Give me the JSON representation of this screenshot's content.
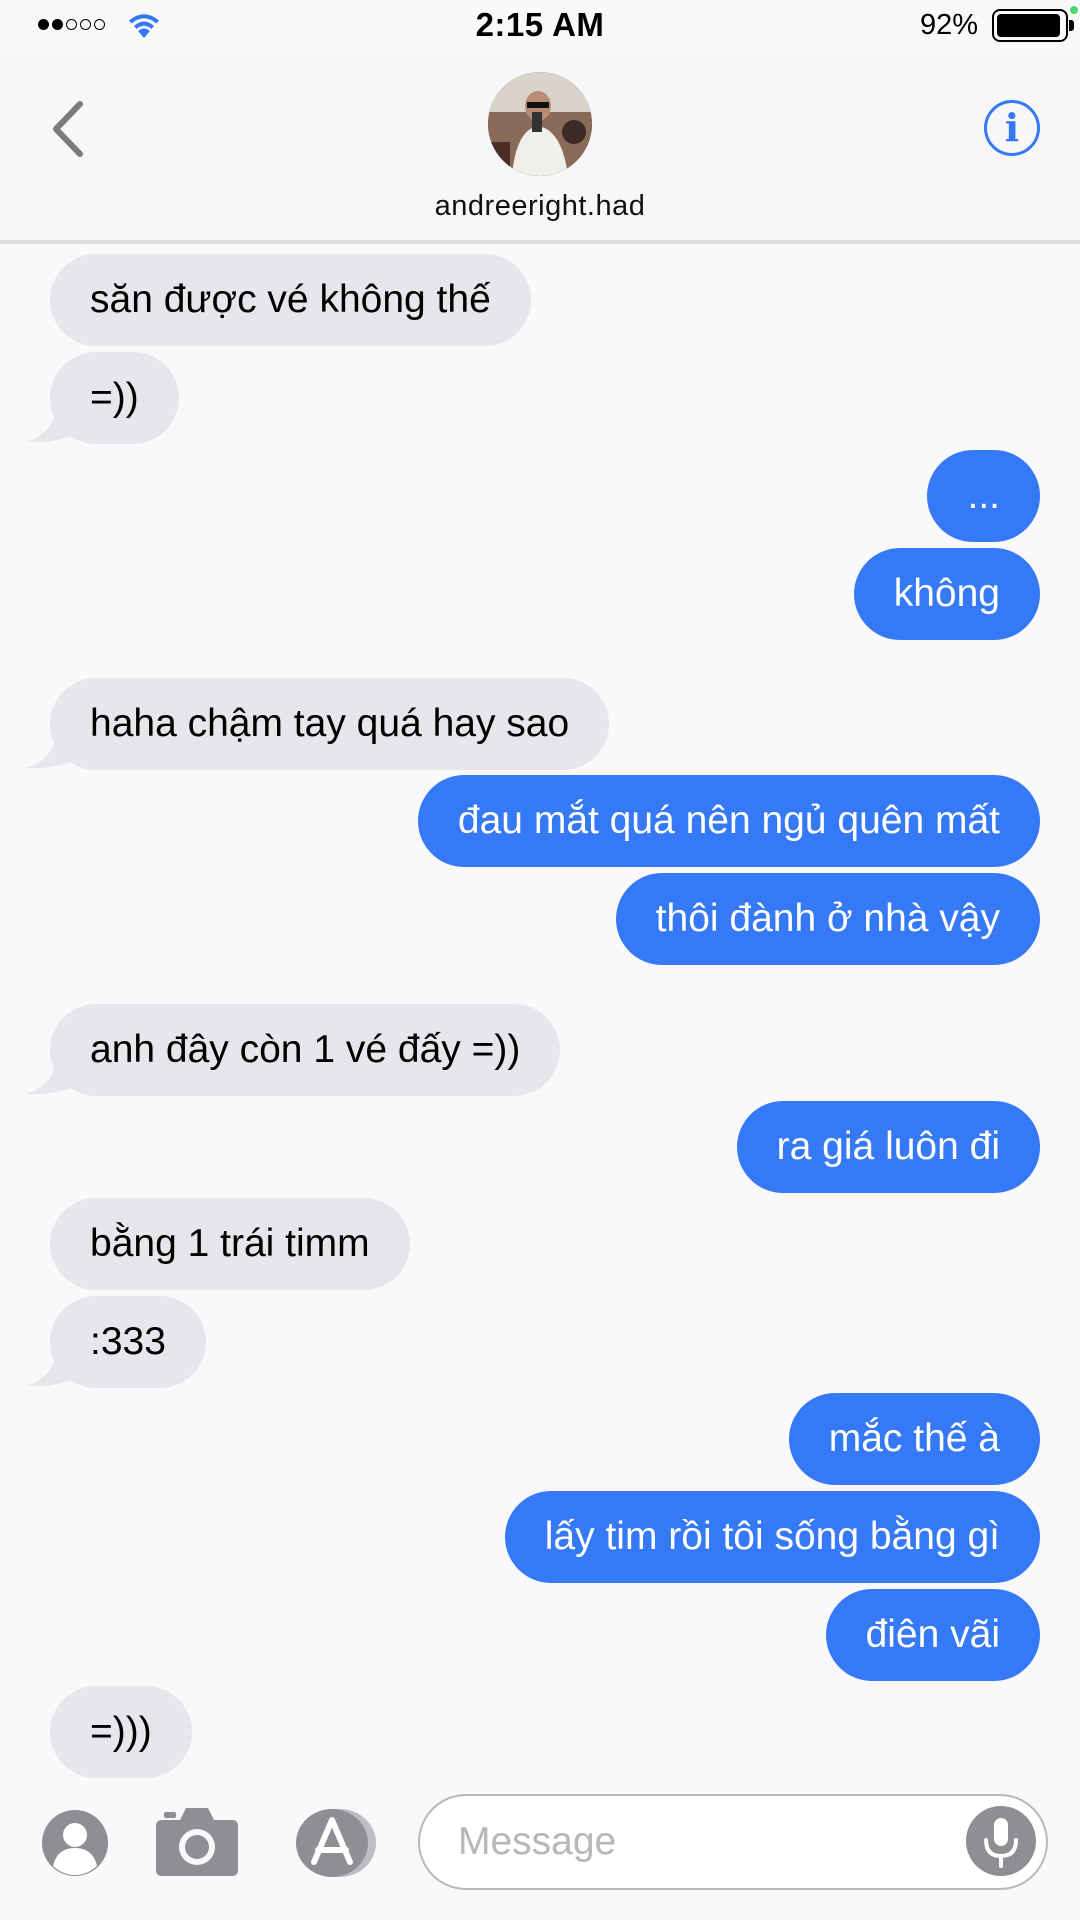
{
  "status_bar": {
    "time": "2:15 AM",
    "battery_percent": "92%",
    "signal_bars_filled": 2,
    "signal_bars_total": 5
  },
  "header": {
    "contact_name": "andreeright.had",
    "back_icon": "chevron-left-icon",
    "info_icon": "info-icon"
  },
  "messages": [
    {
      "direction": "incoming",
      "text": "săn được vé không thế"
    },
    {
      "direction": "incoming",
      "text": "=))"
    },
    {
      "direction": "outgoing",
      "text": "..."
    },
    {
      "direction": "outgoing",
      "text": "không"
    },
    {
      "direction": "incoming",
      "text": "haha chậm tay quá hay sao"
    },
    {
      "direction": "outgoing",
      "text": "đau mắt quá nên ngủ quên mất"
    },
    {
      "direction": "outgoing",
      "text": "thôi đành ở nhà vậy"
    },
    {
      "direction": "incoming",
      "text": "anh đây còn 1 vé đấy =))"
    },
    {
      "direction": "outgoing",
      "text": "ra giá luôn đi"
    },
    {
      "direction": "incoming",
      "text": "bằng 1 trái timm"
    },
    {
      "direction": "incoming",
      "text": ":333"
    },
    {
      "direction": "outgoing",
      "text": "mắc thế à"
    },
    {
      "direction": "outgoing",
      "text": "lấy tim rồi tôi sống bằng gì"
    },
    {
      "direction": "outgoing",
      "text": "điên vãi"
    },
    {
      "direction": "incoming",
      "text": "=)))"
    }
  ],
  "input_bar": {
    "placeholder": "Message",
    "value": "",
    "icons": [
      "contact-icon",
      "camera-icon",
      "app-store-icon",
      "microphone-icon"
    ]
  },
  "colors": {
    "outgoing_bubble": "#3579f6",
    "incoming_bubble": "#e6e6eb",
    "accent": "#3478f6"
  }
}
